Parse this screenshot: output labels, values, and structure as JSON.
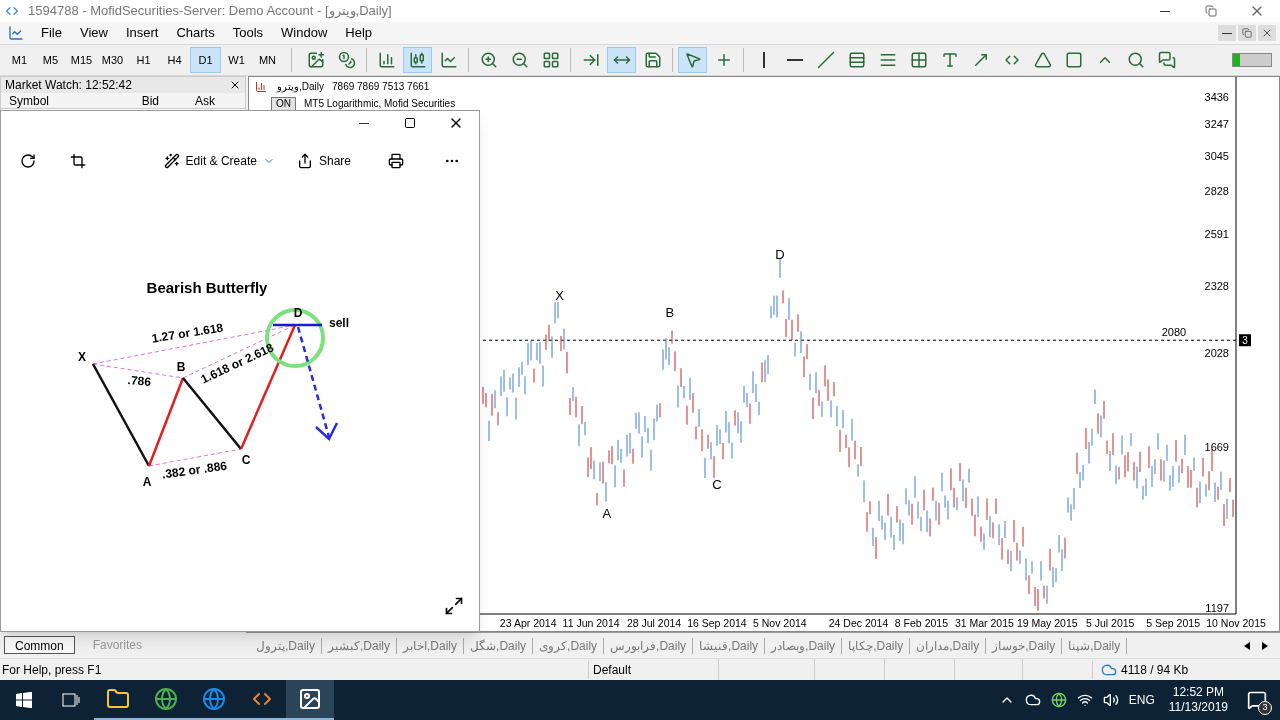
{
  "window": {
    "title": "1594788 - MofidSecurities-Server: Demo Account - [ويترو,Daily]"
  },
  "menu": [
    "File",
    "View",
    "Insert",
    "Charts",
    "Tools",
    "Window",
    "Help"
  ],
  "timeframes": [
    {
      "label": "M1",
      "selected": false
    },
    {
      "label": "M5",
      "selected": false
    },
    {
      "label": "M15",
      "selected": false
    },
    {
      "label": "M30",
      "selected": false
    },
    {
      "label": "H1",
      "selected": false
    },
    {
      "label": "H4",
      "selected": false
    },
    {
      "label": "D1",
      "selected": true
    },
    {
      "label": "W1",
      "selected": false
    },
    {
      "label": "MN",
      "selected": false
    }
  ],
  "tool_buttons": [
    {
      "selected": false
    },
    {
      "selected": false
    },
    {
      "selected": false
    },
    {
      "selected": true
    },
    {
      "selected": false
    },
    {
      "selected": false
    },
    {
      "selected": false
    },
    {
      "selected": false
    },
    {
      "selected": false
    },
    {
      "selected": true
    },
    {
      "selected": false
    },
    {
      "selected": true
    },
    {
      "selected": false
    },
    {
      "selected": false
    },
    {
      "selected": false
    },
    {
      "selected": false
    },
    {
      "selected": false
    },
    {
      "selected": false
    },
    {
      "selected": false
    },
    {
      "selected": false
    },
    {
      "selected": false
    },
    {
      "selected": false
    },
    {
      "selected": false
    },
    {
      "selected": false
    },
    {
      "selected": false
    },
    {
      "selected": false
    },
    {
      "selected": false
    }
  ],
  "market_watch": {
    "title": "Market Watch: 12:52:42",
    "columns": [
      "Symbol",
      "Bid",
      "Ask"
    ]
  },
  "chart": {
    "symbol": "ويترو,Daily",
    "prices": "7869 7869 7513 7661",
    "on_button": "ON",
    "indicator": "MT5 Logarithmic, Mofid Securities",
    "price_line_label": "2080",
    "badge": "3",
    "price_labels": [
      "3436",
      "3247",
      "3045",
      "2828",
      "2591",
      "2328",
      "2028",
      "1669",
      "1197"
    ],
    "date_labels": [
      "23 Apr 2014",
      "11 Jun 2014",
      "28 Jul 2014",
      "16 Sep 2014",
      "5 Nov 2014",
      "24 Dec 2014",
      "8 Feb 2015",
      "31 Mar 2015",
      "19 May 2015",
      "5 Jul 2015",
      "5 Sep 2015",
      "10 Nov 2015"
    ],
    "wave_labels": [
      "X",
      "A",
      "B",
      "C",
      "D"
    ]
  },
  "panel_tabs": [
    {
      "label": "Common",
      "selected": true
    },
    {
      "label": "Favorites",
      "selected": false
    }
  ],
  "chart_tabs": [
    "پترول,Daily",
    "کبشیر,Daily",
    "اخابر,Daily",
    "شگل,Daily",
    "کروی,Daily",
    "فرابورس,Daily",
    "قنیشا,Daily",
    "وبصادر,Daily",
    "چکاپا,Daily",
    "مداران,Daily",
    "خوساز,Daily",
    "شپنا,Daily"
  ],
  "status_bar": {
    "help": "For Help, press F1",
    "profile": "Default",
    "traffic": "4118 / 94 Kb"
  },
  "photo_viewer": {
    "actions": [
      {
        "label": "Edit & Create",
        "kind": "edit"
      },
      {
        "label": "Share",
        "kind": "share"
      }
    ],
    "image": {
      "title": "Bearish Butterfly",
      "points": [
        "X",
        "A",
        "B",
        "C",
        "D"
      ],
      "ratios": [
        "1.27 or 1.618",
        ".786",
        "1.618 or 2.618",
        ".382 or .886"
      ],
      "signal": "sell"
    }
  },
  "taskbar": {
    "apps": [
      {
        "kind": "files",
        "selected": false
      },
      {
        "kind": "chrome",
        "selected": false
      },
      {
        "kind": "edge",
        "selected": false
      },
      {
        "kind": "terminal",
        "selected": false
      },
      {
        "kind": "photos",
        "selected": true
      }
    ],
    "language": "ENG",
    "time": "12:52 PM",
    "date": "11/13/2019",
    "notifications": "3"
  }
}
